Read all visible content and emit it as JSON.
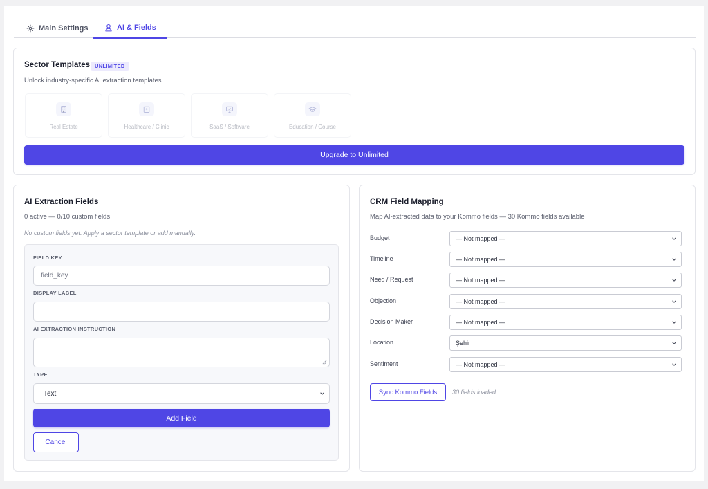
{
  "tabs": [
    {
      "label": "Main Settings",
      "icon": "gear-icon",
      "active": false
    },
    {
      "label": "AI & Fields",
      "icon": "user-icon",
      "active": true
    }
  ],
  "sector_templates": {
    "title": "Sector Templates",
    "badge": "UNLIMITED",
    "subtitle": "Unlock industry-specific AI extraction templates",
    "templates": [
      {
        "label": "Real Estate",
        "icon": "building-icon"
      },
      {
        "label": "Healthcare / Clinic",
        "icon": "hospital-icon"
      },
      {
        "label": "SaaS / Software",
        "icon": "monitor-icon"
      },
      {
        "label": "Education / Course",
        "icon": "graduation-cap-icon"
      }
    ],
    "upgrade_button": "Upgrade to Unlimited"
  },
  "extraction_fields": {
    "title": "AI Extraction Fields",
    "count_text": "0 active — 0/10 custom fields",
    "empty_text": "No custom fields yet. Apply a sector template or add manually.",
    "form": {
      "field_key_label": "FIELD KEY",
      "field_key_placeholder": "field_key",
      "display_label_label": "DISPLAY LABEL",
      "display_label_value": "",
      "instruction_label": "AI EXTRACTION INSTRUCTION",
      "instruction_value": "",
      "type_label": "TYPE",
      "type_value": "Text",
      "add_button": "Add Field",
      "cancel_button": "Cancel"
    }
  },
  "crm_mapping": {
    "title": "CRM Field Mapping",
    "subtitle": "Map AI-extracted data to your Kommo fields — 30 Kommo fields available",
    "rows": [
      {
        "label": "Budget",
        "value": "— Not mapped —"
      },
      {
        "label": "Timeline",
        "value": "— Not mapped —"
      },
      {
        "label": "Need / Request",
        "value": "— Not mapped —"
      },
      {
        "label": "Objection",
        "value": "— Not mapped —"
      },
      {
        "label": "Decision Maker",
        "value": "— Not mapped —"
      },
      {
        "label": "Location",
        "value": "Şehir"
      },
      {
        "label": "Sentiment",
        "value": "— Not mapped —"
      }
    ],
    "sync_button": "Sync Kommo Fields",
    "sync_status": "30 fields loaded"
  },
  "colors": {
    "accent": "#4f46e5",
    "badge_bg": "#eceafd",
    "page_bg": "#f1f1f3"
  }
}
